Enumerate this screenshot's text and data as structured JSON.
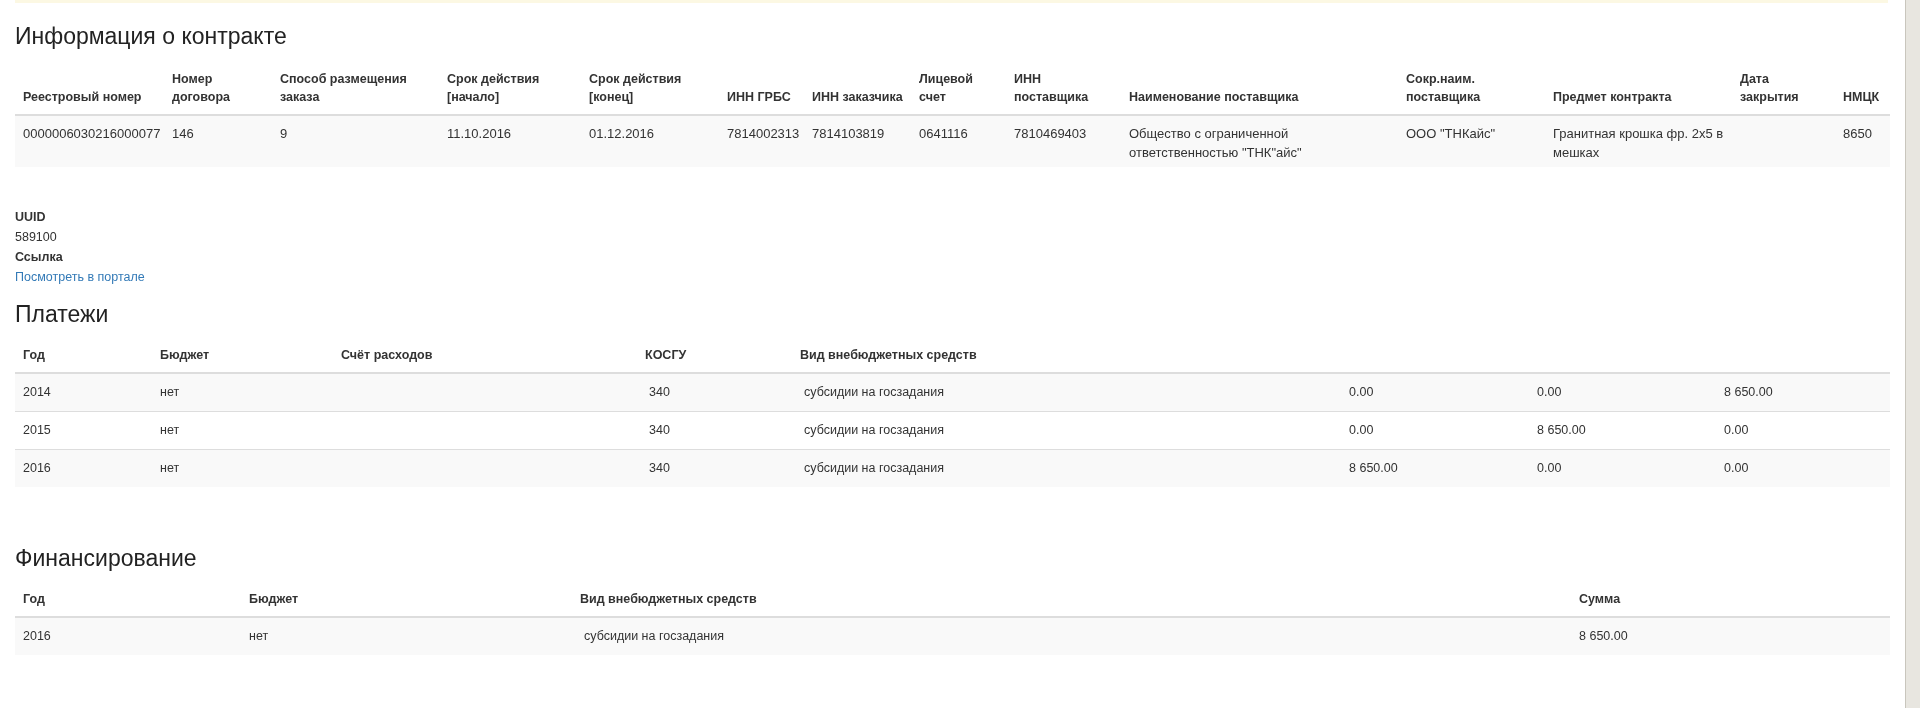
{
  "contract": {
    "title": "Информация о контракте",
    "columns": [
      "Реестровый номер",
      "Номер договора",
      "Способ размещения заказа",
      "Срок действия [начало]",
      "Срок действия [конец]",
      "ИНН ГРБС",
      "ИНН заказчика",
      "Лицевой счет",
      "ИНН поставщика",
      "Наименование поставщика",
      "Сокр.наим. поставщика",
      "Предмет контракта",
      "Дата закрытия",
      "НМЦК"
    ],
    "rows": [
      [
        "0000006030216000077",
        "146",
        "9",
        "11.10.2016",
        "01.12.2016",
        "7814002313",
        "7814103819",
        "0641116",
        "7810469403",
        "Общество с ограниченной ответственностью \"ТНК\"айс\"",
        "ООО \"ТНКайс\"",
        "Гранитная крошка фр. 2х5 в мешках",
        "",
        "8650"
      ]
    ]
  },
  "uuid": {
    "label": "UUID",
    "value": "589100"
  },
  "link": {
    "label": "Ссылка",
    "text": "Посмотреть в портале"
  },
  "payments": {
    "title": "Платежи",
    "columns": [
      "Год",
      "Бюджет",
      "Счёт расходов",
      "КОСГУ",
      "Вид внебюджетных средств",
      "",
      "",
      ""
    ],
    "rows": [
      [
        "2014",
        "нет",
        "",
        "340",
        "субсидии на госзадания",
        "0.00",
        "0.00",
        "8 650.00"
      ],
      [
        "2015",
        "нет",
        "",
        "340",
        "субсидии на госзадания",
        "0.00",
        "8 650.00",
        "0.00"
      ],
      [
        "2016",
        "нет",
        "",
        "340",
        "субсидии на госзадания",
        "8 650.00",
        "0.00",
        "0.00"
      ]
    ]
  },
  "financing": {
    "title": "Финансирование",
    "columns": [
      "Год",
      "Бюджет",
      "Вид внебюджетных средств",
      "Сумма"
    ],
    "rows": [
      [
        "2016",
        "нет",
        "субсидии на госзадания",
        "8 650.00"
      ]
    ]
  }
}
